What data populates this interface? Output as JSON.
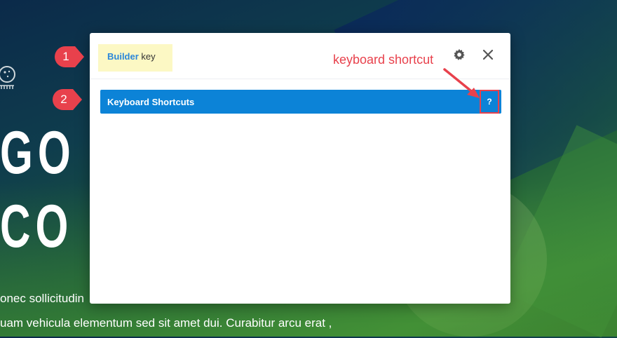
{
  "background": {
    "hero_line1": "GO",
    "hero_line2": "CO",
    "text_line1": "onec sollicitudin",
    "text_line2": "uam vehicula elementum sed sit amet dui. Curabitur arcu erat ,"
  },
  "modal": {
    "tab_accent": "Builder",
    "tab_rest": " key",
    "toggle_label": "Keyboard Shortcuts",
    "help_icon": "?",
    "icons": [
      "gear-icon",
      "close-icon"
    ]
  },
  "annotations": {
    "marker1": "1",
    "marker2": "2",
    "label": "keyboard shortcut"
  },
  "colors": {
    "accent_blue": "#0c83d7",
    "link_blue": "#2b87da",
    "annotation_red": "#e8414c",
    "highlight_yellow": "#fcf8c4"
  }
}
